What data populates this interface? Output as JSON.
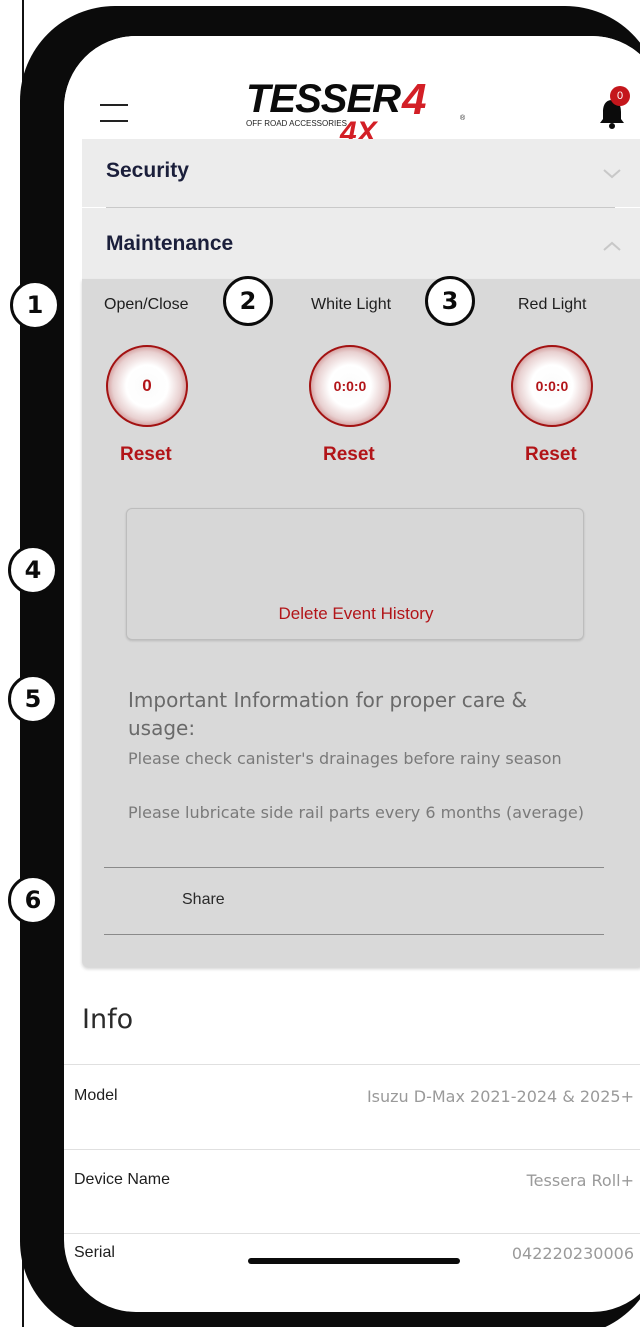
{
  "app": {
    "logo_text": "TESSERA 4X",
    "logo_tagline": "OFF ROAD ACCESSORIES",
    "notification_count": "0"
  },
  "accordion": {
    "security_label": "Security",
    "maintenance_label": "Maintenance"
  },
  "counters": [
    {
      "label": "Open/Close",
      "value": "0",
      "reset_label": "Reset"
    },
    {
      "label": "White Light",
      "value": "0:0:0",
      "reset_label": "Reset"
    },
    {
      "label": "Red Light",
      "value": "0:0:0",
      "reset_label": "Reset"
    }
  ],
  "event_history": {
    "delete_label": "Delete Event History"
  },
  "care": {
    "title": "Important Information for proper care & usage:",
    "tips": [
      "Please check canister's drainages before rainy season",
      "Please lubricate side rail parts every 6 months (average)"
    ]
  },
  "share_label": "Share",
  "info": {
    "heading": "Info",
    "rows": [
      {
        "key": "Model",
        "value": "Isuzu D-Max 2021-2024 & 2025+"
      },
      {
        "key": "Device Name",
        "value": "Tessera Roll+"
      },
      {
        "key": "Serial",
        "value": "042220230006"
      }
    ]
  },
  "callouts": [
    "1",
    "2",
    "3",
    "4",
    "5",
    "6"
  ],
  "colors": {
    "accent_red": "#b21418",
    "panel_gray": "#d9d9d9",
    "header_gray": "#ececec",
    "navy_text": "#1b1f3b"
  },
  "icons": {
    "menu": "hamburger-icon",
    "notifications": "bell-icon",
    "expand": "chevron-down-icon",
    "collapse": "chevron-up-icon"
  }
}
